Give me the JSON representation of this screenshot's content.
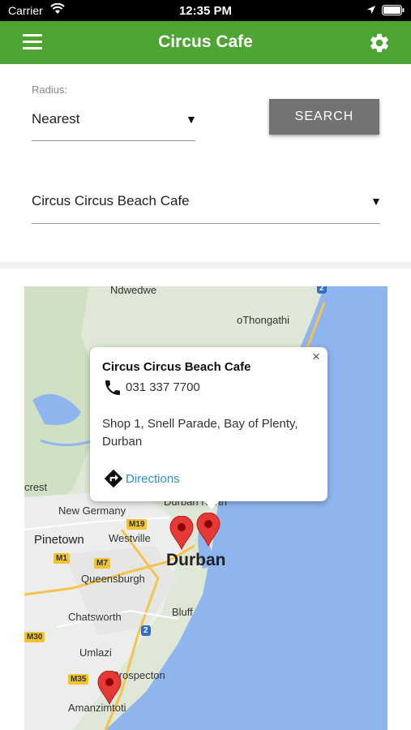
{
  "status_bar": {
    "carrier": "Carrier",
    "time": "12:35 PM"
  },
  "header": {
    "title": "Circus Cafe"
  },
  "form": {
    "radius_label": "Radius:",
    "radius_value": "Nearest",
    "search_label": "SEARCH",
    "cafe_value": "Circus Circus Beach Cafe"
  },
  "map": {
    "labels": {
      "ndwedwe": "Ndwedwe",
      "othongathi": "oThongathi",
      "crest": "crest",
      "new_germany": "New Germany",
      "pinetown": "Pinetown",
      "westville": "Westville",
      "durban": "Durban",
      "queensburgh": "Queensburgh",
      "chatsworth": "Chatsworth",
      "bluff": "Bluff",
      "umlazi": "Umlazi",
      "prospecton": "Prospecton",
      "amanzimtoti": "Amanzimtoti",
      "durban_north": "Durban North"
    },
    "shields": {
      "m19": "M19",
      "m1": "M1",
      "m7": "M7",
      "m30": "M30",
      "m35": "M35",
      "n2a": "2",
      "n2b": "2",
      "n2c": "2"
    }
  },
  "popup": {
    "name": "Circus Circus Beach Cafe",
    "phone": "031 337 7700",
    "address": "Shop 1, Snell Parade, Bay of Plenty, Durban",
    "directions": "Directions",
    "close": "×"
  },
  "colors": {
    "header": "#4ea534",
    "link": "#2d8fd4",
    "button": "#737373",
    "sea": "#8fb5ef",
    "pin": "#e53935"
  },
  "icons": [
    "wifi-icon",
    "location-arrow-icon",
    "battery-icon",
    "menu-icon",
    "gear-icon",
    "dropdown-caret-icon",
    "phone-icon",
    "directions-icon",
    "map-pin-icon",
    "close-icon"
  ]
}
